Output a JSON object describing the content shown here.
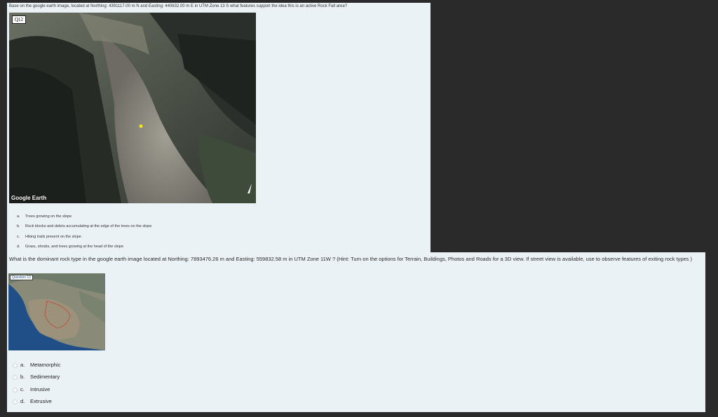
{
  "question1": {
    "text": "Base on the google earth image, located at Northing: 4391117.00 m N and Easting: 440632.00 m E in UTM Zone 13 S what features support the idea this is an active Rock Fall area?",
    "badge": "Q12",
    "map_logo": "Google Earth",
    "options": [
      {
        "letter": "a.",
        "label": "Trees growing on the slope"
      },
      {
        "letter": "b.",
        "label": "Rock blocks and debris accumulating at the edge of the trees on the slope"
      },
      {
        "letter": "c.",
        "label": "Hiking trails present on the slope"
      },
      {
        "letter": "d.",
        "label": "Grass, shrubs, and trees growing at the head of the slope"
      }
    ]
  },
  "question2": {
    "text": "What is the dominant rock type in the google earth image located at Northing: 7893476.26 m and Easting: 559832.58 m in UTM Zone 11W ? (Hint: Turn on the options for Terrain, Buildings, Photos and Roads for a 3D view. If street view is available, use to observe features of exiting rock types )",
    "badge": "Question 13",
    "options": [
      {
        "letter": "a.",
        "label": "Metamorphic"
      },
      {
        "letter": "b.",
        "label": "Sedimentary"
      },
      {
        "letter": "c.",
        "label": "Intrusive"
      },
      {
        "letter": "d.",
        "label": "Extrusive"
      }
    ]
  }
}
